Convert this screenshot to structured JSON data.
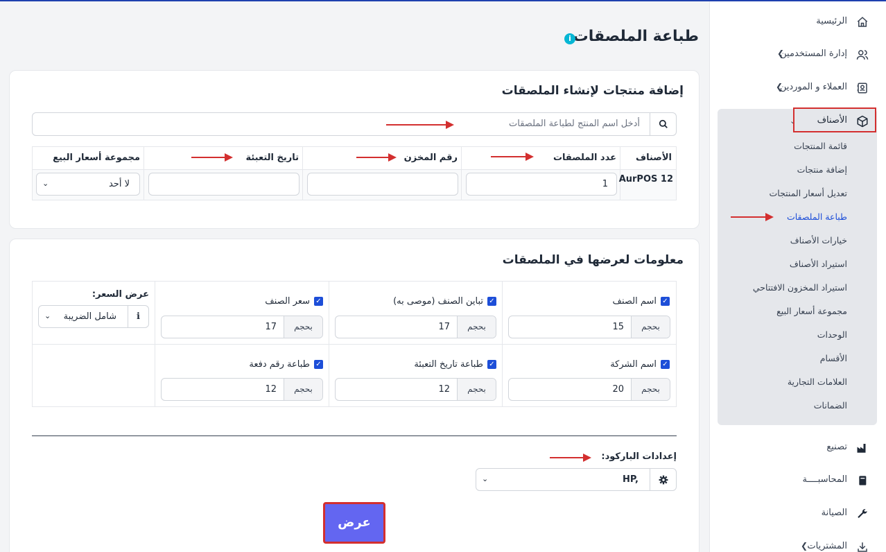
{
  "sidebar": {
    "home": "الرئيسية",
    "users": "إدارة المستخدمين",
    "customers": "العملاء و الموردين",
    "products": "الأصناف",
    "sub": [
      "قائمة المنتجات",
      "إضافة منتجات",
      "تعديل أسعار المنتجات",
      "طباعة الملصقات",
      "خيارات الأصناف",
      "استيراد الأصناف",
      "استيراد المخزون الافتتاحي",
      "مجموعة أسعار البيع",
      "الوحدات",
      "الأقسام",
      "العلامات التجارية",
      "الضمانات"
    ],
    "manufacturing": "تصنيع",
    "accounting": "المحاسبــــة",
    "maintenance": "الصيانة",
    "purchases": "المشتريات"
  },
  "page": {
    "title": "طباعة الملصقات",
    "info": "i"
  },
  "add_card": {
    "title": "إضافة منتجات لإنشاء الملصقات",
    "search_placeholder": "أدخل اسم المنتج لطباعة الملصقات",
    "columns": [
      "الأصناف",
      "عدد الملصقات",
      "رقم المخزن",
      "تاريخ التعبئة",
      "مجموعة أسعار البيع"
    ],
    "row": {
      "product": "AurPOS 12",
      "count": "1",
      "warehouse": "",
      "packing_date": "",
      "price_group": "لا أحد"
    }
  },
  "info_card": {
    "title": "معلومات لعرضها في الملصقات",
    "size_prefix": "بحجم",
    "fields": [
      {
        "label": "اسم الصنف",
        "size": "15"
      },
      {
        "label": "تباين الصنف (موصى به)",
        "size": "17"
      },
      {
        "label": "سعر الصنف",
        "size": "17"
      },
      {
        "label": "اسم الشركة",
        "size": "20"
      },
      {
        "label": "طباعة تاريخ التعبئة",
        "size": "12"
      },
      {
        "label": "طباعة رقم دفعة",
        "size": "12"
      }
    ],
    "price_display_label": "عرض السعر:",
    "price_display_value": "شامل الضريبة",
    "barcode_label": "إعدادات الباركود:",
    "barcode_value": "HP,",
    "submit": "عرض"
  }
}
